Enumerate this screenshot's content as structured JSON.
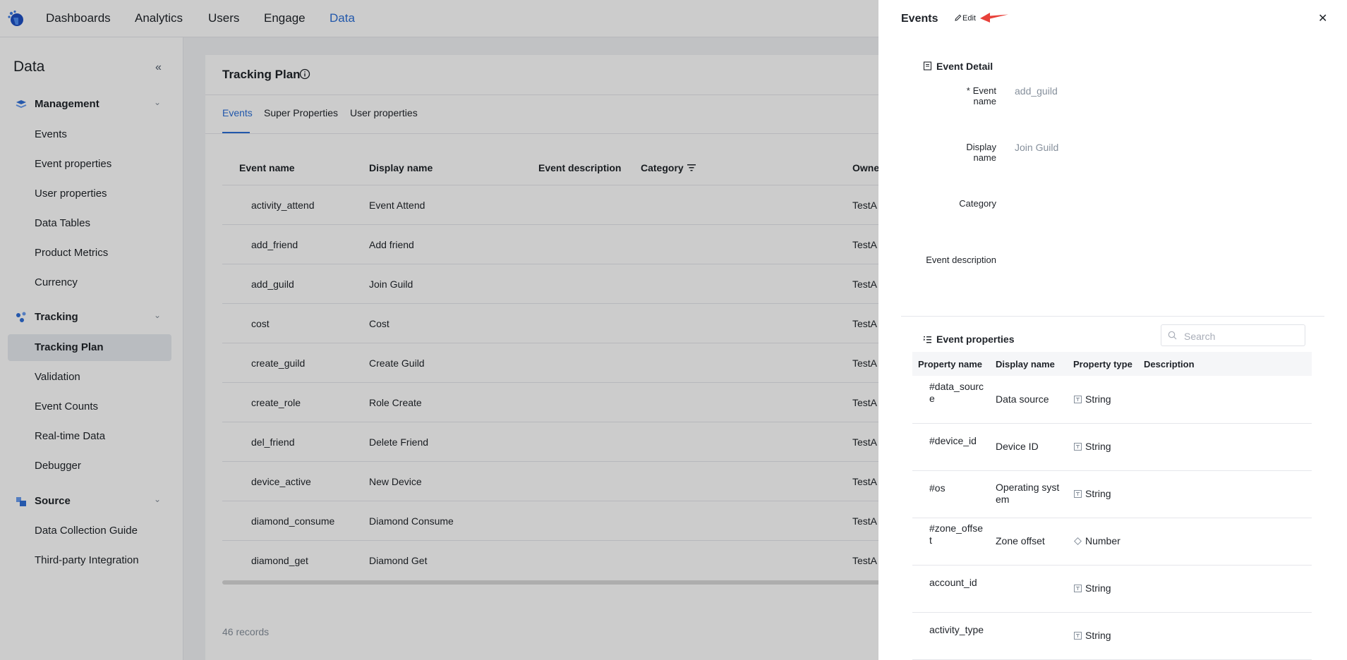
{
  "nav": {
    "items": [
      "Dashboards",
      "Analytics",
      "Users",
      "Engage",
      "Data"
    ],
    "active": "Data"
  },
  "sidebar": {
    "title": "Data",
    "groups": [
      {
        "label": "Management",
        "items": [
          "Events",
          "Event properties",
          "User properties",
          "Data Tables",
          "Product Metrics",
          "Currency"
        ]
      },
      {
        "label": "Tracking",
        "items": [
          "Tracking Plan",
          "Validation",
          "Event Counts",
          "Real-time Data",
          "Debugger"
        ]
      },
      {
        "label": "Source",
        "items": [
          "Data Collection Guide",
          "Third-party Integration"
        ]
      }
    ],
    "active_item": "Tracking Plan"
  },
  "main": {
    "title": "Tracking Plan",
    "tabs": [
      "Events",
      "Super Properties",
      "User properties"
    ],
    "active_tab": "Events",
    "columns": [
      "Event name",
      "Display name",
      "Event description",
      "Category",
      "Owner"
    ],
    "rows": [
      {
        "event_name": "activity_attend",
        "display_name": "Event Attend",
        "owner": "TestA"
      },
      {
        "event_name": "add_friend",
        "display_name": "Add friend",
        "owner": "TestA"
      },
      {
        "event_name": "add_guild",
        "display_name": "Join Guild",
        "owner": "TestA"
      },
      {
        "event_name": "cost",
        "display_name": "Cost",
        "owner": "TestA"
      },
      {
        "event_name": "create_guild",
        "display_name": "Create Guild",
        "owner": "TestA"
      },
      {
        "event_name": "create_role",
        "display_name": "Role Create",
        "owner": "TestA"
      },
      {
        "event_name": "del_friend",
        "display_name": "Delete Friend",
        "owner": "TestA"
      },
      {
        "event_name": "device_active",
        "display_name": "New Device",
        "owner": "TestA"
      },
      {
        "event_name": "diamond_consume",
        "display_name": "Diamond Consume",
        "owner": "TestA"
      },
      {
        "event_name": "diamond_get",
        "display_name": "Diamond Get",
        "owner": "TestA"
      }
    ],
    "records": "46 records"
  },
  "drawer": {
    "title": "Events",
    "edit_label": "Edit",
    "detail_section": "Event Detail",
    "fields": {
      "event_name_label": "Event name",
      "event_name_value": "add_guild",
      "display_name_label": "Display name",
      "display_name_value": "Join Guild",
      "category_label": "Category",
      "description_label": "Event description"
    },
    "props_section": "Event properties",
    "search_placeholder": "Search",
    "prop_columns": [
      "Property name",
      "Display name",
      "Property type",
      "Description"
    ],
    "props": [
      {
        "name": [
          "#data_sourc",
          "e"
        ],
        "display": [
          "Data source"
        ],
        "type": "String",
        "type_icon": "string-type-icon"
      },
      {
        "name": [
          "#device_id"
        ],
        "display": [
          "Device ID"
        ],
        "type": "String",
        "type_icon": "string-type-icon"
      },
      {
        "name": [
          "#os"
        ],
        "display": [
          "Operating syst",
          "em"
        ],
        "type": "String",
        "type_icon": "string-type-icon"
      },
      {
        "name": [
          "#zone_offse",
          "t"
        ],
        "display": [
          "Zone offset"
        ],
        "type": "Number",
        "type_icon": "number-type-icon"
      },
      {
        "name": [
          "account_id"
        ],
        "display": [],
        "type": "String",
        "type_icon": "string-type-icon"
      },
      {
        "name": [
          "activity_type"
        ],
        "display": [],
        "type": "String",
        "type_icon": "string-type-icon"
      }
    ]
  },
  "colors": {
    "accent": "#2b6fd6",
    "annotation_arrow": "#e8413a"
  }
}
